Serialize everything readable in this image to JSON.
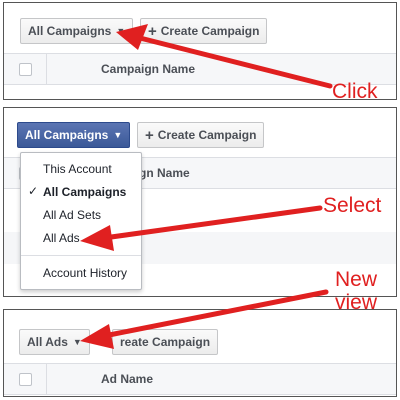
{
  "panel1": {
    "dropdown_label": "All Campaigns",
    "create_label": "Create Campaign",
    "column_header": "Campaign Name"
  },
  "panel2": {
    "dropdown_label": "All Campaigns",
    "create_label": "Create Campaign",
    "column_header": "aign Name",
    "menu": {
      "items": [
        {
          "label": "This Account",
          "selected": false
        },
        {
          "label": "All Campaigns",
          "selected": true
        },
        {
          "label": "All Ad Sets",
          "selected": false
        },
        {
          "label": "All Ads",
          "selected": false
        }
      ],
      "history_label": "Account History"
    }
  },
  "panel3": {
    "dropdown_label": "All Ads",
    "create_label": "reate Campaign",
    "column_header": "Ad Name"
  },
  "annotations": {
    "step1": "Click",
    "step2": "Select",
    "step3_line1": "New",
    "step3_line2": "view",
    "color": "#e02020"
  },
  "icons": {
    "caret": "▼",
    "plus": "+",
    "check": "✓"
  },
  "colors": {
    "brand_blue": "#3b5998",
    "arrow_red": "#e02020"
  }
}
